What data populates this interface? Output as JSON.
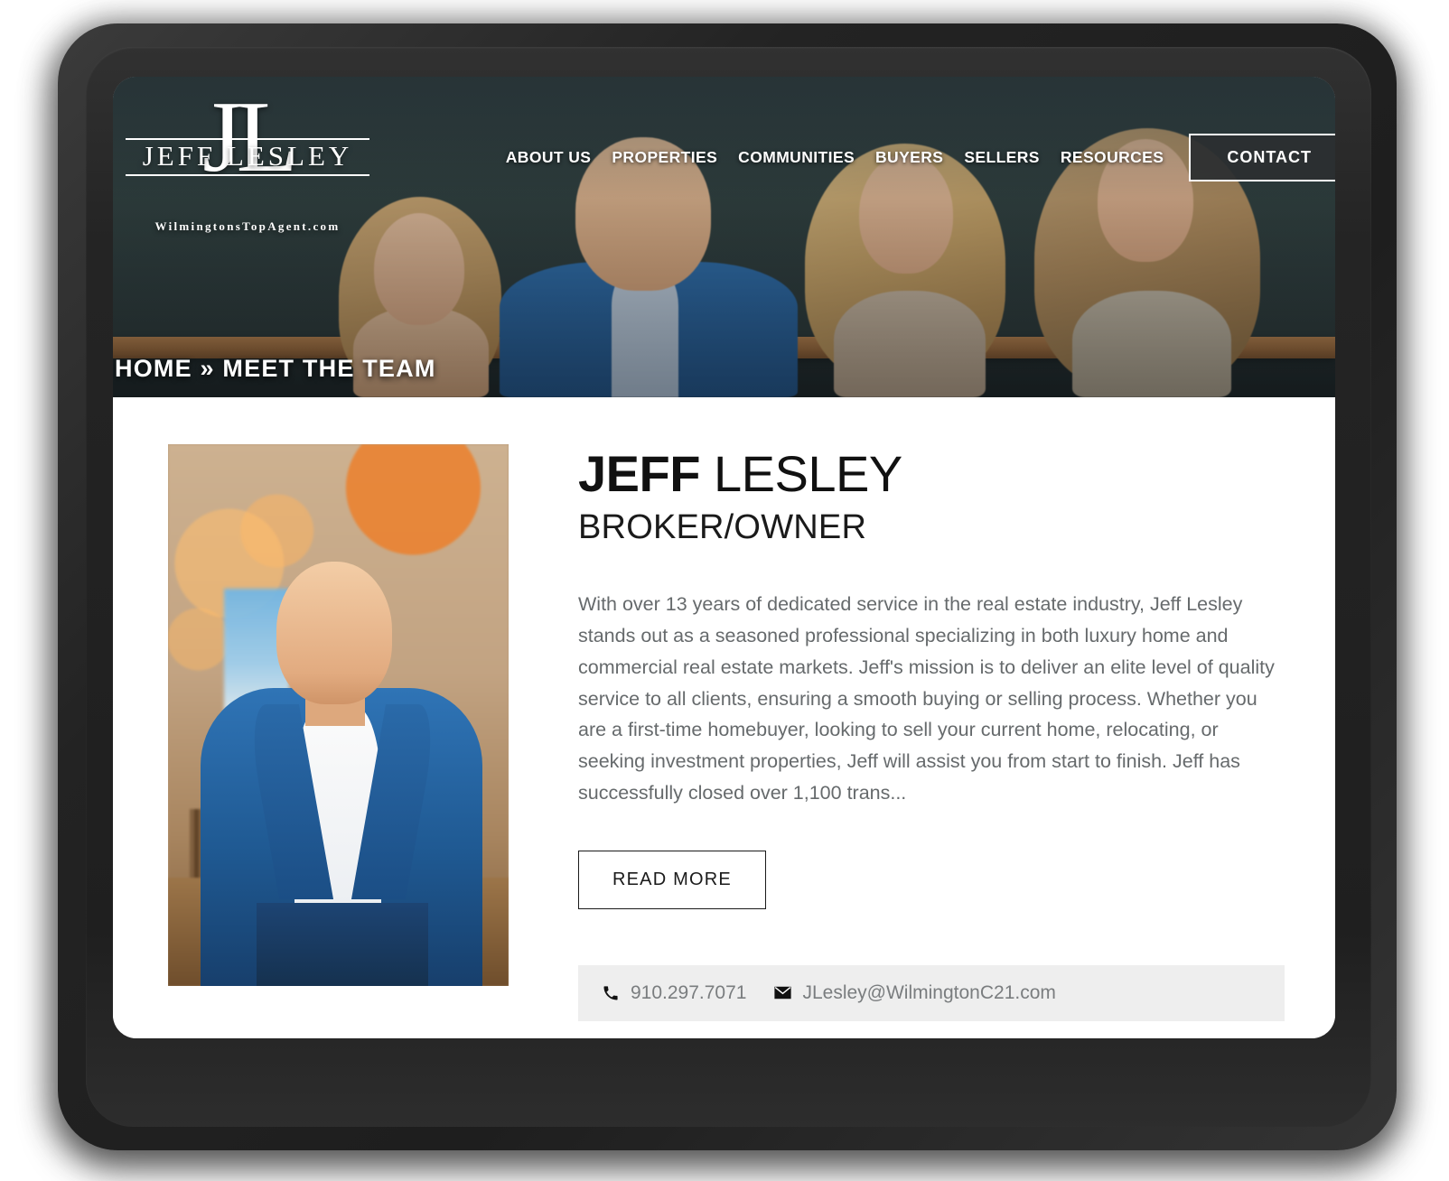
{
  "brand": {
    "monogram": "JL",
    "name": "JEFF LESLEY",
    "tagline": "WilmingtonsTopAgent.com",
    "accent_dark": "#2b2e30",
    "hero_wall_color": "#30403f",
    "contact_bar_color": "#eeeeee",
    "body_text_color": "#666a6c"
  },
  "nav": {
    "items": [
      {
        "label": "ABOUT US"
      },
      {
        "label": "PROPERTIES"
      },
      {
        "label": "COMMUNITIES"
      },
      {
        "label": "BUYERS"
      },
      {
        "label": "SELLERS"
      },
      {
        "label": "RESOURCES"
      }
    ],
    "cta_label": "CONTACT"
  },
  "breadcrumb": {
    "text": "HOME » MEET THE TEAM"
  },
  "agent": {
    "first_name": "JEFF",
    "last_name": " LESLEY",
    "title": "BROKER/OWNER",
    "bio": "With over 13 years of dedicated service in the real estate industry, Jeff Lesley stands out as a seasoned professional specializing in both luxury home and commercial real estate markets. Jeff's mission is to deliver an elite level of quality service to all clients, ensuring a smooth buying or selling process. Whether you are a first-time homebuyer, looking to sell your current home, relocating, or seeking investment properties, Jeff will assist you from start to finish. Jeff has successfully closed over 1,100 trans...",
    "read_more_label": "READ MORE",
    "phone": "910.297.7071",
    "email": "JLesley@WilmingtonC21.com",
    "phone_icon": "phone-icon",
    "email_icon": "envelope-icon"
  }
}
